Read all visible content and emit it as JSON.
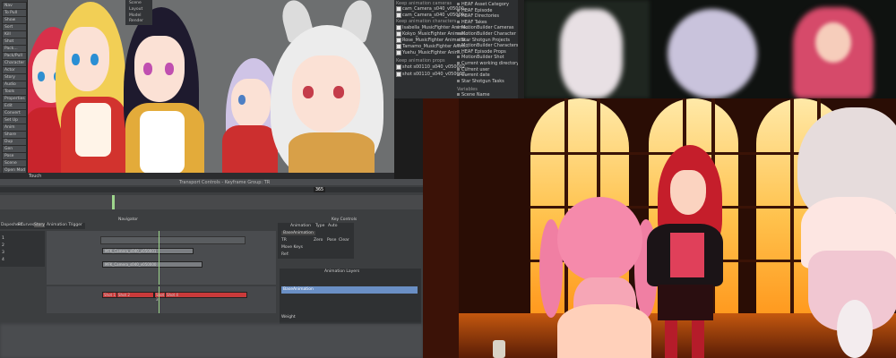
{
  "viewport": {
    "rail_buttons": [
      "Nav",
      "To Pull",
      "Show",
      "Sort",
      "Kill",
      "Shot",
      "Pack...",
      "Pack/Pull",
      "Character",
      "Actor",
      "Story",
      "Audio",
      "Tools",
      "Properties",
      "Edit",
      "Convert",
      "Set Up",
      "Anim",
      "Share",
      "Dup",
      "Gen",
      "Pose",
      "Scene",
      "Open Mod"
    ],
    "top_menu": [
      "Scene",
      "Layout",
      "Model",
      "Render"
    ],
    "footer_label": "Touch"
  },
  "asset_panel": {
    "sections": [
      "Keep animation cameras",
      "Keep animation characters",
      "Keep animation props"
    ],
    "left_items": [
      "cam_Camera_s040_v05000...",
      "cam_Camera_s040_v05000...",
      "Isabella_MusicFighter Anima...",
      "Kokyo_MusicFighter Animat...",
      "Rose_MusicFighter Animatio...",
      "Tamamo_MusicFighter Anim...",
      "Yuehu_MusicFighter Anim...",
      "shot s00110_s040_v050002...",
      "shot s00110_s040_v050002..."
    ],
    "right_items": [
      "HEAF Asset Category",
      "HEAF Episode",
      "HEAF Directories",
      "HEAF Takes",
      "MotionBuilder Cameras",
      "MotionBuilder Character Poses",
      "Star Shotgun Projects",
      "MotionBuilder Characters",
      "HEAF Episode Props",
      "MotionBuilder Shot",
      "Current working directory",
      "Current user",
      "Current date",
      "Star Shotgun Tasks",
      "Scene Name"
    ],
    "right_heading": "Variables"
  },
  "editor": {
    "title": "Transport Controls - Keyframe Group: TR",
    "tabs": [
      "Dopesheet",
      "FCurves",
      "Story",
      "Animation Trigger"
    ],
    "navigator_label": "Navigator",
    "key_controls_label": "Key Controls",
    "animation_label": "Animation",
    "type_label": "Type",
    "type_value": "Auto",
    "base_animation": "BaseAnimation",
    "tr_label": "TR",
    "zero_label": "Zero",
    "pose_label": "Pose",
    "clear_label": "Clear",
    "move_keys_label": "Move Keys",
    "ref_label": "Ref:",
    "layers_title": "Animation Layers",
    "layer_name": "BaseAnimation",
    "weight_label": "Weight",
    "track_labels": [
      "1",
      "2",
      "3",
      "4"
    ],
    "clip_labels": [
      "MFK_Camera_s040_v050001",
      "MFK_Camera_s040_v050000"
    ],
    "shot_labels": [
      "Shot 1",
      "Shot 2",
      "Shot 3",
      "Shot 4"
    ],
    "frame_readout": "365"
  },
  "colors": {
    "accent_orange": "#ff9a1f",
    "clip_red": "#c93a3a",
    "layer_blue": "#6a8fc5"
  }
}
